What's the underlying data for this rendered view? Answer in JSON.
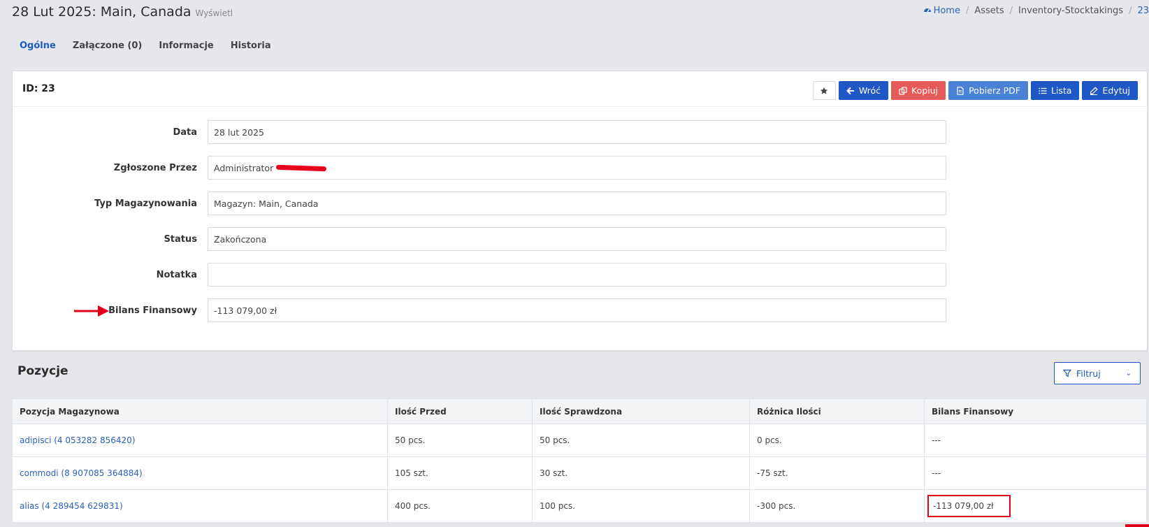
{
  "header": {
    "title": "28 Lut 2025: Main, Canada",
    "subtitle": "Wyświetl"
  },
  "breadcrumb": [
    "Home",
    "Assets",
    "Inventory-Stocktakings",
    "23"
  ],
  "tabs": [
    "Ogólne",
    "Załączone (0)",
    "Informacje",
    "Historia"
  ],
  "card": {
    "id_label": "ID: 23",
    "buttons": {
      "back": "Wróć",
      "copy": "Kopiuj",
      "pdf": "Pobierz PDF",
      "list": "Lista",
      "edit": "Edytuj"
    },
    "fields": [
      {
        "label": "Data",
        "value": "28 lut 2025"
      },
      {
        "label": "Zgłoszone Przez",
        "value": "Administrator"
      },
      {
        "label": "Typ Magazynowania",
        "value": "Magazyn: Main, Canada"
      },
      {
        "label": "Status",
        "value": "Zakończona"
      },
      {
        "label": "Notatka",
        "value": ""
      },
      {
        "label": "Bilans Finansowy",
        "value": "-113 079,00 zł"
      }
    ]
  },
  "positions": {
    "title": "Pozycje",
    "filter_label": "Filtruj",
    "columns": [
      "Pozycja Magazynowa",
      "Ilość Przed",
      "Ilość Sprawdzona",
      "Różnica Ilości",
      "Bilans Finansowy"
    ],
    "rows": [
      [
        "adipisci (4 053282 856420)",
        "50 pcs.",
        "50 pcs.",
        "0 pcs.",
        "---"
      ],
      [
        "commodi (8 907085 364884)",
        "105 szt.",
        "30 szt.",
        "-75 szt.",
        "---"
      ],
      [
        "alias (4 289454 629831)",
        "400 pcs.",
        "100 pcs.",
        "-300 pcs.",
        "-113 079,00 zł"
      ]
    ]
  },
  "colors": {
    "primary": "#1e58c6",
    "danger": "#e65a5a",
    "info": "#4a82d8",
    "annotation": "#e3001b"
  }
}
